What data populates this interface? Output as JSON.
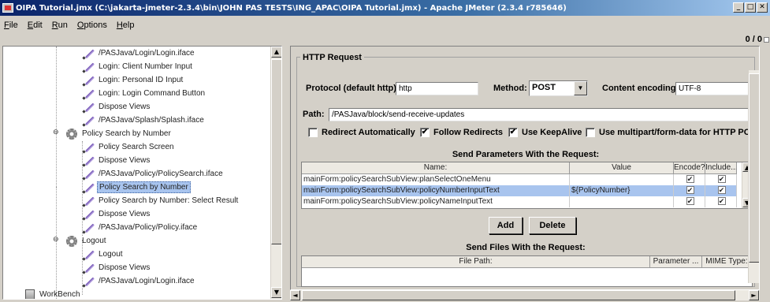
{
  "window": {
    "title": "OIPA Tutorial.jmx (C:\\jakarta-jmeter-2.3.4\\bin\\JOHN PAS TESTS\\ING_APAC\\OIPA Tutorial.jmx) - Apache JMeter (2.3.4 r785646)",
    "minimize": "_",
    "maximize": "□",
    "close": "✕"
  },
  "menu": [
    "File",
    "Edit",
    "Run",
    "Options",
    "Help"
  ],
  "toolbar": {
    "counter": "0 / 0"
  },
  "tree": {
    "items": [
      {
        "label": "/PASJava/Login/Login.iface",
        "icon": "sampler-icon"
      },
      {
        "label": "Login: Client Number Input",
        "icon": "sampler-icon"
      },
      {
        "label": "Login: Personal ID Input",
        "icon": "sampler-icon"
      },
      {
        "label": "Login: Login Command Button",
        "icon": "sampler-icon"
      },
      {
        "label": "Dispose Views",
        "icon": "sampler-icon"
      },
      {
        "label": "/PASJava/Splash/Splash.iface",
        "icon": "sampler-icon"
      },
      {
        "label": "Policy Search by Number",
        "icon": "controller-icon"
      },
      {
        "label": "Policy Search Screen",
        "icon": "sampler-icon"
      },
      {
        "label": "Dispose Views",
        "icon": "sampler-icon"
      },
      {
        "label": "/PASJava/Policy/PolicySearch.iface",
        "icon": "sampler-icon"
      },
      {
        "label": "Policy Search by Number",
        "icon": "sampler-icon",
        "selected": true
      },
      {
        "label": "Policy Search by Number: Select Result",
        "icon": "sampler-icon"
      },
      {
        "label": "Dispose Views",
        "icon": "sampler-icon"
      },
      {
        "label": "/PASJava/Policy/Policy.iface",
        "icon": "sampler-icon"
      },
      {
        "label": "Logout",
        "icon": "controller-icon"
      },
      {
        "label": "Logout",
        "icon": "sampler-icon"
      },
      {
        "label": "Dispose Views",
        "icon": "sampler-icon"
      },
      {
        "label": "/PASJava/Login/Login.iface",
        "icon": "sampler-icon"
      },
      {
        "label": "WorkBench",
        "icon": "workbench-icon"
      }
    ]
  },
  "http": {
    "group_title": "HTTP Request",
    "protocol_label": "Protocol (default http):",
    "protocol_value": "http",
    "method_label": "Method:",
    "method_value": "POST",
    "encoding_label": "Content encoding:",
    "encoding_value": "UTF-8",
    "path_label": "Path:",
    "path_value": "/PASJava/block/send-receive-updates",
    "redirect_auto": {
      "label": "Redirect Automatically",
      "checked": false
    },
    "follow_redirects": {
      "label": "Follow Redirects",
      "checked": true
    },
    "keepalive": {
      "label": "Use KeepAlive",
      "checked": true
    },
    "multipart": {
      "label": "Use multipart/form-data for HTTP POST",
      "checked": false
    },
    "params_heading": "Send Parameters With the Request:",
    "params_columns": [
      "Name:",
      "Value",
      "Encode?",
      "Include..."
    ],
    "params_rows": [
      {
        "name": "mainForm:policySearchSubView:planSelectOneMenu",
        "value": "",
        "encode": "✔",
        "include": "✔"
      },
      {
        "name": "mainForm:policySearchSubView:policyNumberInputText",
        "value": "${PolicyNumber}",
        "encode": "✔",
        "include": "✔",
        "selected": true
      },
      {
        "name": "mainForm:policySearchSubView:policyNameInputText",
        "value": "",
        "encode": "✔",
        "include": "✔"
      }
    ],
    "add_label": "Add",
    "delete_label": "Delete",
    "files_heading": "Send Files With the Request:",
    "files_columns": [
      "File Path:",
      "Parameter ...",
      "MIME Type:"
    ]
  }
}
